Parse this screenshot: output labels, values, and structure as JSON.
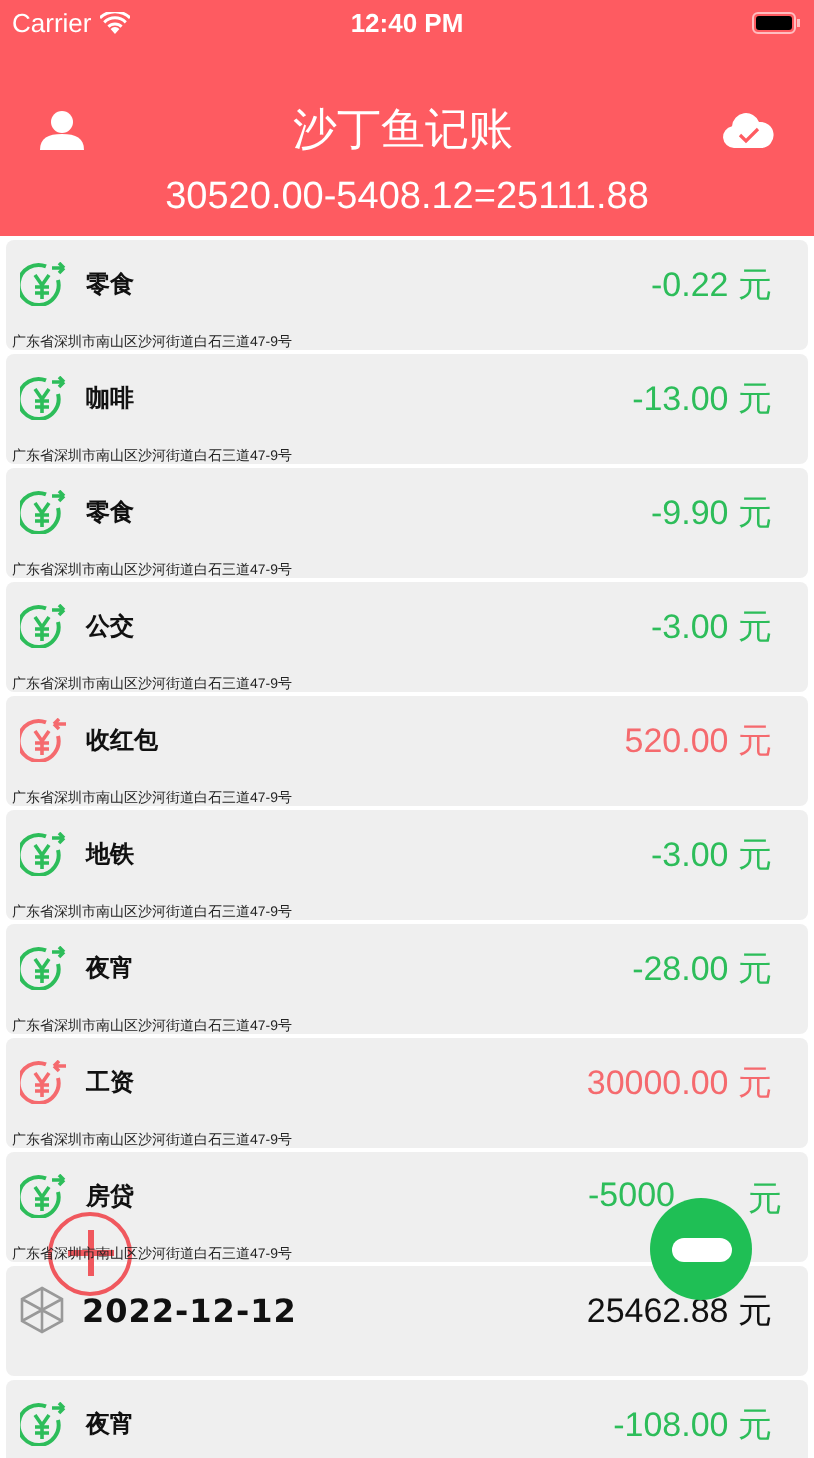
{
  "status_bar": {
    "carrier": "Carrier",
    "time": "12:40 PM"
  },
  "header": {
    "title": "沙丁鱼记账",
    "summary": "30520.00-5408.12=25111.88"
  },
  "records": [
    {
      "kind": "expense",
      "label": "零食",
      "amount": "-0.22",
      "unit": "元",
      "address": "广东省深圳市南山区沙河街道白石三道47-9号",
      "cut": false
    },
    {
      "kind": "expense",
      "label": "咖啡",
      "amount": "-13.00",
      "unit": "元",
      "address": "广东省深圳市南山区沙河街道白石三道47-9号",
      "cut": false
    },
    {
      "kind": "expense",
      "label": "零食",
      "amount": "-9.90",
      "unit": "元",
      "address": "广东省深圳市南山区沙河街道白石三道47-9号",
      "cut": false
    },
    {
      "kind": "expense",
      "label": "公交",
      "amount": "-3.00",
      "unit": "元",
      "address": "广东省深圳市南山区沙河街道白石三道47-9号",
      "cut": false
    },
    {
      "kind": "income",
      "label": "收红包",
      "amount": "520.00",
      "unit": "元",
      "address": "广东省深圳市南山区沙河街道白石三道47-9号",
      "cut": false
    },
    {
      "kind": "expense",
      "label": "地铁",
      "amount": "-3.00",
      "unit": "元",
      "address": "广东省深圳市南山区沙河街道白石三道47-9号",
      "cut": false
    },
    {
      "kind": "expense",
      "label": "夜宵",
      "amount": "-28.00",
      "unit": "元",
      "address": "广东省深圳市南山区沙河街道白石三道47-9号",
      "cut": false
    },
    {
      "kind": "income",
      "label": "工资",
      "amount": "30000.00",
      "unit": "元",
      "address": "广东省深圳市南山区沙河街道白石三道47-9号",
      "cut": false
    },
    {
      "kind": "expense",
      "label": "房贷",
      "amount": "-5000",
      "unit": "元",
      "address": "广东省深圳市南山区沙河街道白石三道47-9号",
      "cut": true
    },
    {
      "kind": "summary",
      "label": "2022-12-12",
      "amount": "25462.88",
      "unit": "元",
      "cut": false
    },
    {
      "kind": "expense",
      "label": "夜宵",
      "amount": "-108.00",
      "unit": "元",
      "cut": false
    }
  ]
}
